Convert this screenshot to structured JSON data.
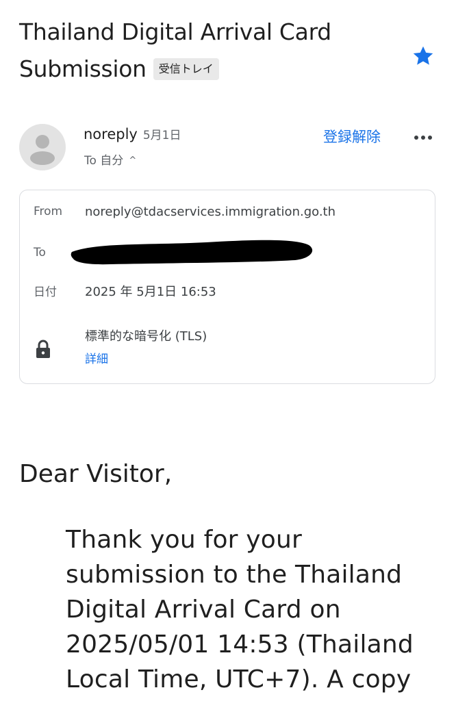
{
  "email": {
    "subject": "Thailand Digital Arrival Card Submission",
    "label_chip": "受信トレイ",
    "starred": true,
    "colors": {
      "star": "#1a73e8",
      "link": "#1a73e8"
    }
  },
  "sender": {
    "name": "noreply",
    "date": "5月1日",
    "to_summary": "To 自分",
    "unsubscribe": "登録解除"
  },
  "details": {
    "from_label": "From",
    "from_value": "noreply@tdacservices.immigration.go.th",
    "to_label": "To",
    "date_label": "日付",
    "date_value": "2025 年 5月1日 16:53",
    "encryption": "標準的な暗号化 (TLS)",
    "details_link": "詳細"
  },
  "body": {
    "greeting": "Dear Visitor,",
    "paragraph": "Thank you for your submission to the Thailand Digital Arrival Card on 2025/05/01 14:53 (Thailand Local Time, UTC+7). A copy"
  },
  "icons": {
    "star": "star-icon",
    "avatar": "person-icon",
    "more": "more-horizontal-icon",
    "lock": "lock-icon",
    "chevron": "chevron-up-icon"
  }
}
